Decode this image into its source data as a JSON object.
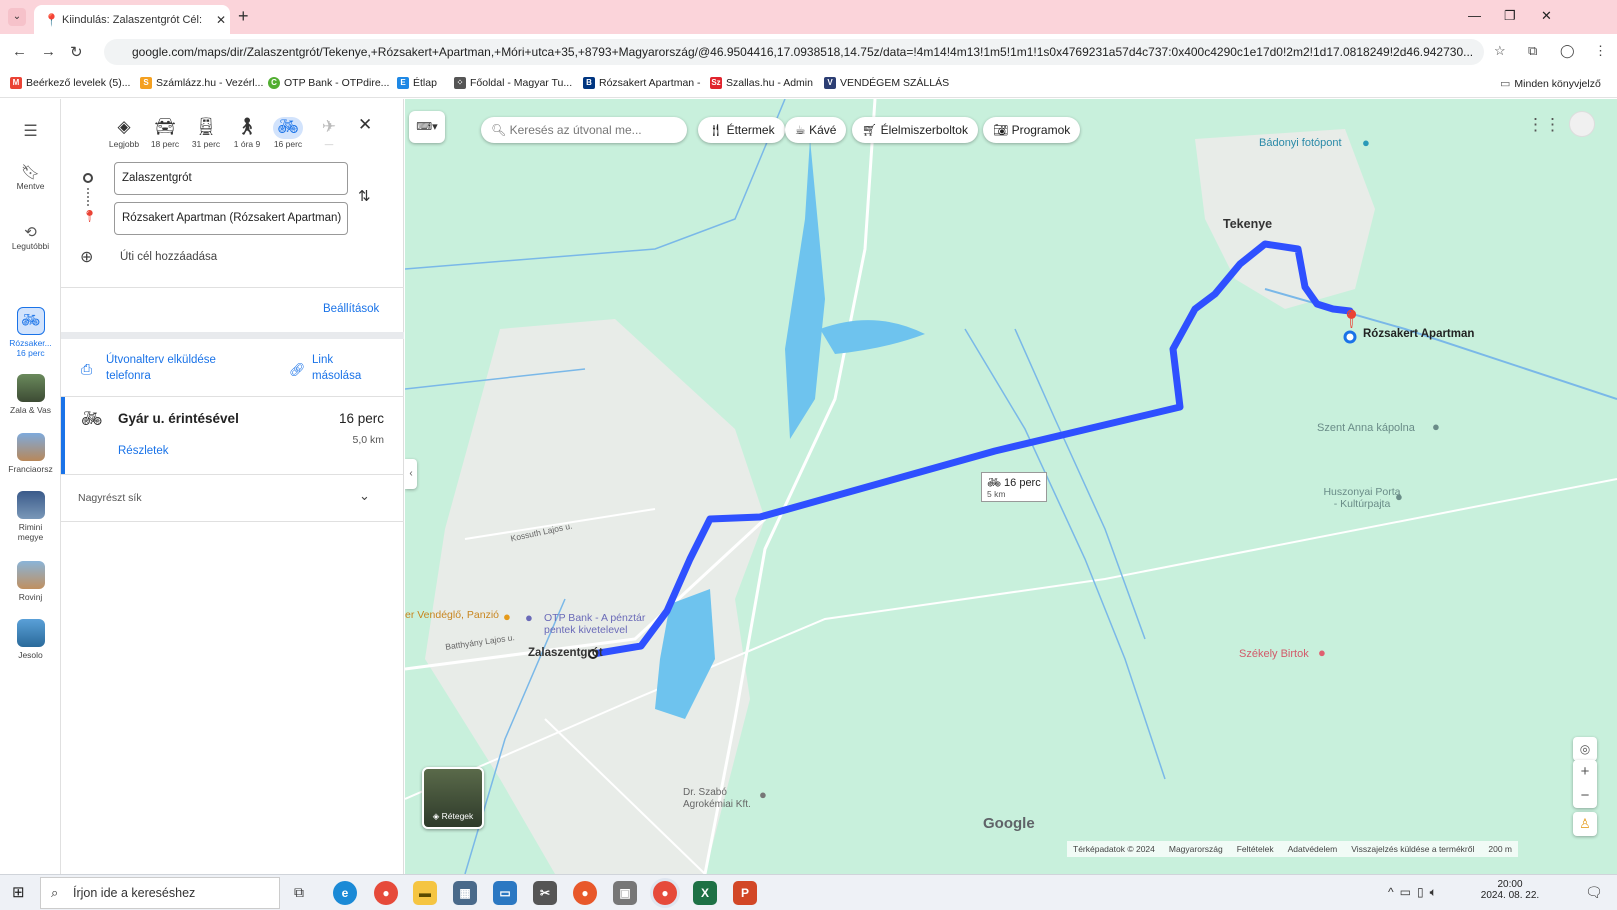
{
  "browser": {
    "tab_title": "Kiindulás: Zalaszentgrót Cél: Ró",
    "url": "google.com/maps/dir/Zalaszentgrót/Tekenye,+Rózsakert+Apartman,+Móri+utca+35,+8793+Magyarország/@46.9504416,17.0938518,14.75z/data=!4m14!4m13!1m5!1m1!1s0x4769231a57d4c737:0x400c4290c1e17d0!2m2!1d17.0818249!2d46.942730..."
  },
  "bookmarks": [
    {
      "label": "Beérkező levelek (5)...",
      "icon": "gmail-icon",
      "color": "#ea4335"
    },
    {
      "label": "Számlázz.hu - Vezérl...",
      "icon": "szamlazz-icon",
      "color": "#f4a020"
    },
    {
      "label": "OTP Bank - OTPdire...",
      "icon": "otp-icon",
      "color": "#52ae32"
    },
    {
      "label": "Étlap",
      "icon": "etlap-icon",
      "color": "#1e88e5"
    },
    {
      "label": "Főoldal - Magyar Tu...",
      "icon": "magyar-turizmus-icon",
      "color": "#555555"
    },
    {
      "label": "Rózsakert Apartman -",
      "icon": "booking-icon",
      "color": "#003580"
    },
    {
      "label": "Szallas.hu - Admin",
      "icon": "szallas-icon",
      "color": "#e0242d"
    },
    {
      "label": "VENDÉGEM SZÁLLÁS",
      "icon": "vendegem-icon",
      "color": "#2c3e73"
    },
    {
      "label": "Minden könyvjelző",
      "icon": "folder-icon",
      "color": "#555555"
    }
  ],
  "rail": {
    "items": [
      {
        "label": "Mentve",
        "icon": "bookmark-icon"
      },
      {
        "label": "Legutóbbi",
        "icon": "history-icon"
      },
      {
        "label": "Rózsaker... 16 perc",
        "icon": "bike-icon"
      },
      {
        "label": "Zala & Vas",
        "icon": "thumbnail"
      },
      {
        "label": "Franciaorsz",
        "icon": "thumbnail"
      },
      {
        "label": "Rimini megye",
        "icon": "thumbnail"
      },
      {
        "label": "Rovinj",
        "icon": "thumbnail"
      },
      {
        "label": "Jesolo",
        "icon": "thumbnail"
      }
    ]
  },
  "modes": [
    {
      "label": "Legjobb",
      "icon": "diamond-route-icon",
      "active": false
    },
    {
      "label": "18 perc",
      "icon": "car-icon",
      "active": false
    },
    {
      "label": "31 perc",
      "icon": "transit-icon",
      "active": false
    },
    {
      "label": "1 óra 9",
      "icon": "walk-icon",
      "active": false
    },
    {
      "label": "16 perc",
      "icon": "bike-icon",
      "active": true
    },
    {
      "label": "—",
      "icon": "plane-icon",
      "active": false
    }
  ],
  "directions": {
    "origin": "Zalaszentgrót",
    "destination": "Rózsakert Apartman (Rózsakert Apartman)",
    "add_destination": "Úti cél hozzáadása",
    "settings": "Beállítások",
    "send_to_phone": "Útvonalterv elküldése telefonra",
    "copy_link": "Link másolása",
    "route_name": "Gyár u. érintésével",
    "route_time": "16 perc",
    "route_distance": "5,0 km",
    "details": "Részletek",
    "terrain": "Nagyrészt sík"
  },
  "map": {
    "search_placeholder": "Keresés az útvonal me...",
    "chips": [
      {
        "label": "Éttermek",
        "icon": "fork-knife-icon"
      },
      {
        "label": "Kávé",
        "icon": "coffee-icon"
      },
      {
        "label": "Élelmiszerboltok",
        "icon": "cart-icon"
      },
      {
        "label": "Programok",
        "icon": "camera-icon"
      }
    ],
    "labels": {
      "tekenye": "Tekenye",
      "destination": "Rózsakert Apartman",
      "badonyi": "Bádonyi fotópont",
      "szent_anna": "Szent Anna kápolna",
      "huszonyai": "Huszonyai Porta - Kultúrpajta",
      "szekely": "Székely Birtok",
      "zalaszentgrot": "Zalaszentgrót",
      "vendeglo": "er Vendéglő, Panzió",
      "otp": "OTP Bank - A pénztár pentek kivetelevel",
      "drszabo": "Dr. Szabó Agrokémiai Kft.",
      "kossuth": "Kossuth Lajos u.",
      "batthyany": "Batthyány Lajos u.",
      "route_time": "16 perc",
      "route_distance": "5 km",
      "layers": "Rétegek",
      "google": "Google"
    },
    "footer": [
      "Térképadatok © 2024",
      "Magyarország",
      "Feltételek",
      "Adatvédelem",
      "Visszajelzés küldése a termékről",
      "200 m"
    ]
  },
  "taskbar": {
    "search_placeholder": "Írjon ide a kereséshez",
    "time": "20:00",
    "date": "2024. 08. 22."
  },
  "colors": {
    "route": "#2f50ff",
    "map_bg": "#c8f0dc",
    "accent": "#1a73e8"
  }
}
